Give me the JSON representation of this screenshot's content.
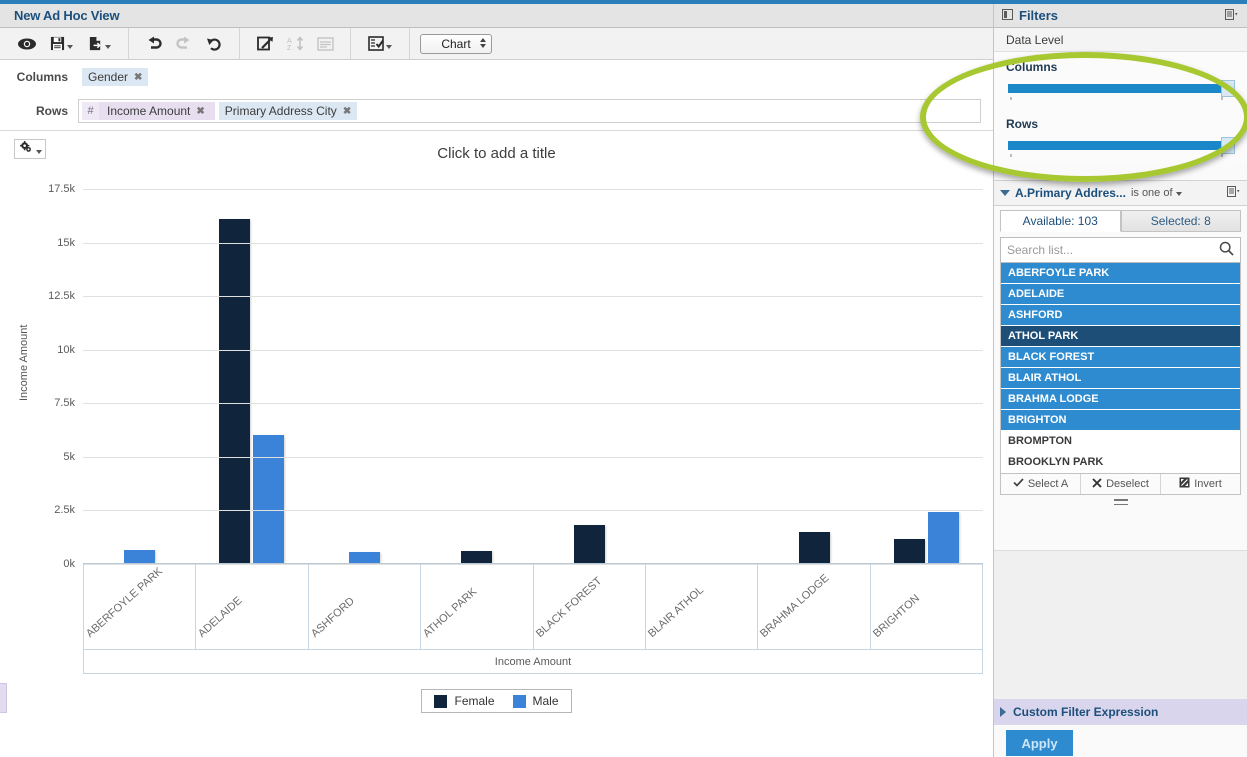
{
  "window": {
    "title": "New Ad Hoc View"
  },
  "toolbar": {
    "buttons": [
      {
        "name": "view-preview",
        "icon": "eye-icon",
        "label": "",
        "enabled": true
      },
      {
        "name": "save",
        "icon": "save-icon",
        "label": "",
        "enabled": true,
        "has_caret": true
      },
      {
        "name": "export",
        "icon": "export-icon",
        "label": "",
        "enabled": true,
        "has_caret": true
      },
      {
        "name": "undo",
        "icon": "undo-icon",
        "label": "",
        "enabled": true
      },
      {
        "name": "redo",
        "icon": "redo-icon",
        "label": "",
        "enabled": false
      },
      {
        "name": "revert",
        "icon": "revert-icon",
        "label": "",
        "enabled": true
      },
      {
        "name": "switch-group",
        "icon": "switch-icon",
        "label": "",
        "enabled": true
      },
      {
        "name": "sort",
        "icon": "sort-az-icon",
        "label": "",
        "enabled": false
      },
      {
        "name": "table-format",
        "icon": "table-icon",
        "label": "",
        "enabled": false
      },
      {
        "name": "select-mode",
        "icon": "checklist-icon",
        "label": "",
        "enabled": true,
        "has_caret": true
      }
    ],
    "view_select": {
      "value": "Chart",
      "options": [
        "Chart"
      ]
    }
  },
  "dropzones": {
    "columns_label": "Columns",
    "columns_chips": [
      {
        "text": "Gender",
        "type": "dimension"
      }
    ],
    "rows_label": "Rows",
    "rows_chips": [
      {
        "text": "Income Amount",
        "type": "measure",
        "prefix": "#"
      },
      {
        "text": "Primary Address City",
        "type": "dimension"
      }
    ],
    "remove_glyph": "✖"
  },
  "chart": {
    "settings_icon": "gear-icon",
    "title_placeholder": "Click to add a title"
  },
  "chart_data": {
    "type": "bar",
    "title": "Click to add a title",
    "xlabel": "Income Amount",
    "ylabel": "Income Amount",
    "ylim": [
      0,
      17500
    ],
    "yticks": [
      0,
      2500,
      5000,
      7500,
      10000,
      12500,
      15000,
      17500
    ],
    "ytick_labels": [
      "0k",
      "2.5k",
      "5k",
      "7.5k",
      "10k",
      "12.5k",
      "15k",
      "17.5k"
    ],
    "grid": true,
    "legend_position": "bottom",
    "categories": [
      "ABERFOYLE PARK",
      "ADELAIDE",
      "ASHFORD",
      "ATHOL PARK",
      "BLACK FOREST",
      "BLAIR ATHOL",
      "BRAHMA LODGE",
      "BRIGHTON"
    ],
    "series": [
      {
        "name": "Female",
        "color": "#10253c",
        "values": [
          0,
          16100,
          0,
          600,
          1800,
          0,
          1500,
          1150
        ]
      },
      {
        "name": "Male",
        "color": "#3b83d8",
        "values": [
          670,
          6000,
          550,
          0,
          0,
          0,
          0,
          2450
        ]
      }
    ]
  },
  "filters": {
    "header_title": "Filters",
    "header_icon": "panel-icon",
    "header_menu_icon": "menu-icon",
    "data_level_label": "Data Level",
    "sliders": [
      {
        "name": "Columns",
        "value": 100,
        "min": 0,
        "max": 100
      },
      {
        "name": "Rows",
        "value": 100,
        "min": 0,
        "max": 100
      }
    ],
    "filter_name": "A.Primary Addres...",
    "filter_operator": "is one of",
    "filter_menu_icon": "menu-icon",
    "tabs": [
      {
        "label": "Available: 103",
        "active": true
      },
      {
        "label": "Selected: 8",
        "active": false
      }
    ],
    "search_placeholder": "Search list...",
    "search_value": "",
    "search_icon": "search-icon",
    "list_items": [
      {
        "text": "ABERFOYLE PARK",
        "state": "selected"
      },
      {
        "text": "ADELAIDE",
        "state": "selected"
      },
      {
        "text": "ASHFORD",
        "state": "selected"
      },
      {
        "text": "ATHOL PARK",
        "state": "highlighted"
      },
      {
        "text": "BLACK FOREST",
        "state": "selected"
      },
      {
        "text": "BLAIR ATHOL",
        "state": "selected"
      },
      {
        "text": "BRAHMA LODGE",
        "state": "selected"
      },
      {
        "text": "BRIGHTON",
        "state": "selected"
      },
      {
        "text": "BROMPTON",
        "state": "normal"
      },
      {
        "text": "BROOKLYN PARK",
        "state": "normal"
      }
    ],
    "actions": [
      {
        "label": "Select A",
        "icon": "check-icon"
      },
      {
        "label": "Deselect",
        "icon": "x-icon"
      },
      {
        "label": "Invert",
        "icon": "invert-icon"
      }
    ],
    "custom_filter_expression": "Custom Filter Expression",
    "apply_label": "Apply"
  },
  "colors": {
    "accent_blue": "#2e8bd0",
    "female_bar": "#10253c",
    "male_bar": "#3b83d8",
    "annotation_green": "#a8c832",
    "title_text": "#1c4f7c"
  }
}
